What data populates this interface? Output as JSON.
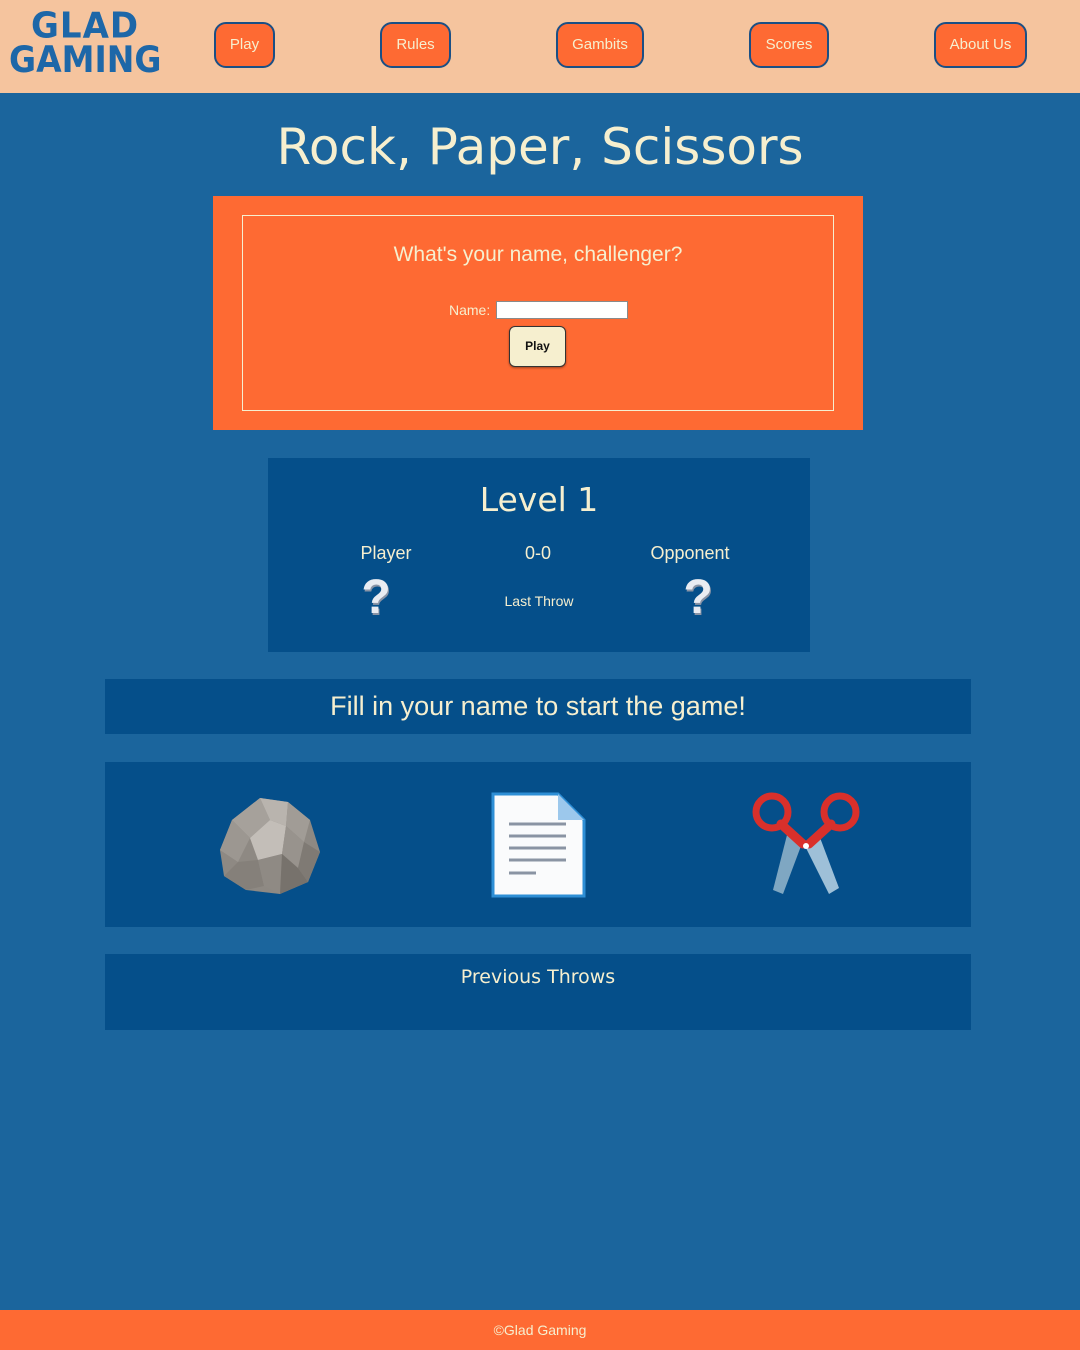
{
  "header": {
    "logo_line1": "GLAD",
    "logo_line2": "GAMING",
    "nav": [
      "Play",
      "Rules",
      "Gambits",
      "Scores",
      "About Us"
    ]
  },
  "main": {
    "title": "Rock, Paper, Scissors",
    "name_card": {
      "question": "What's your name, challenger?",
      "name_label": "Name:",
      "name_value": "",
      "play_label": "Play"
    },
    "level": {
      "title": "Level 1",
      "player_label": "Player",
      "score": "0-0",
      "opponent_label": "Opponent",
      "player_throw": "?",
      "opponent_throw": "?",
      "last_throw_label": "Last Throw"
    },
    "message": "Fill in your name to start the game!",
    "choices": [
      {
        "name": "rock",
        "icon": "rock-icon"
      },
      {
        "name": "paper",
        "icon": "paper-icon"
      },
      {
        "name": "scissors",
        "icon": "scissors-icon"
      }
    ],
    "previous_throws_title": "Previous Throws"
  },
  "footer": {
    "text": "©Glad Gaming"
  },
  "colors": {
    "header_bg": "#f5c49e",
    "page_bg": "#1b659d",
    "panel_bg": "#054f8a",
    "accent": "#fe6a33",
    "text": "#f6efcf",
    "logo": "#1d67a8"
  }
}
